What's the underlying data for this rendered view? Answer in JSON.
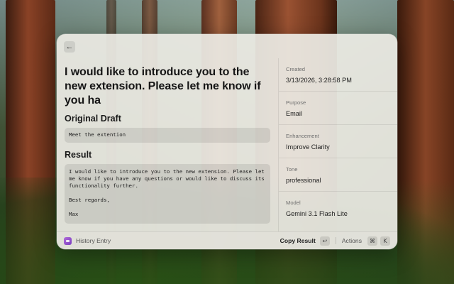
{
  "panel": {
    "back_icon_glyph": "←",
    "headline": "I would like to introduce you to the new extension. Please let me know if you ha",
    "draft_heading": "Original Draft",
    "draft_text": "Meet the extention",
    "result_heading": "Result",
    "result_text": "I would like to introduce you to the new extension. Please let me know if you have any questions or would like to discuss its functionality further.\n\nBest regards,\n\nMax"
  },
  "details": [
    {
      "label": "Created",
      "value": "3/13/2026, 3:28:58 PM"
    },
    {
      "label": "Purpose",
      "value": "Email"
    },
    {
      "label": "Enhancement",
      "value": "Improve Clarity"
    },
    {
      "label": "Tone",
      "value": "professional"
    },
    {
      "label": "Model",
      "value": "Gemini 3.1 Flash Lite"
    }
  ],
  "footer": {
    "title": "History Entry",
    "copy_label": "Copy Result",
    "copy_shortcut": "↩",
    "actions_label": "Actions",
    "actions_key_1": "⌘",
    "actions_key_2": "K"
  },
  "colors": {
    "accent": "#9b59d0",
    "panel_bg": "#ecebe4"
  }
}
